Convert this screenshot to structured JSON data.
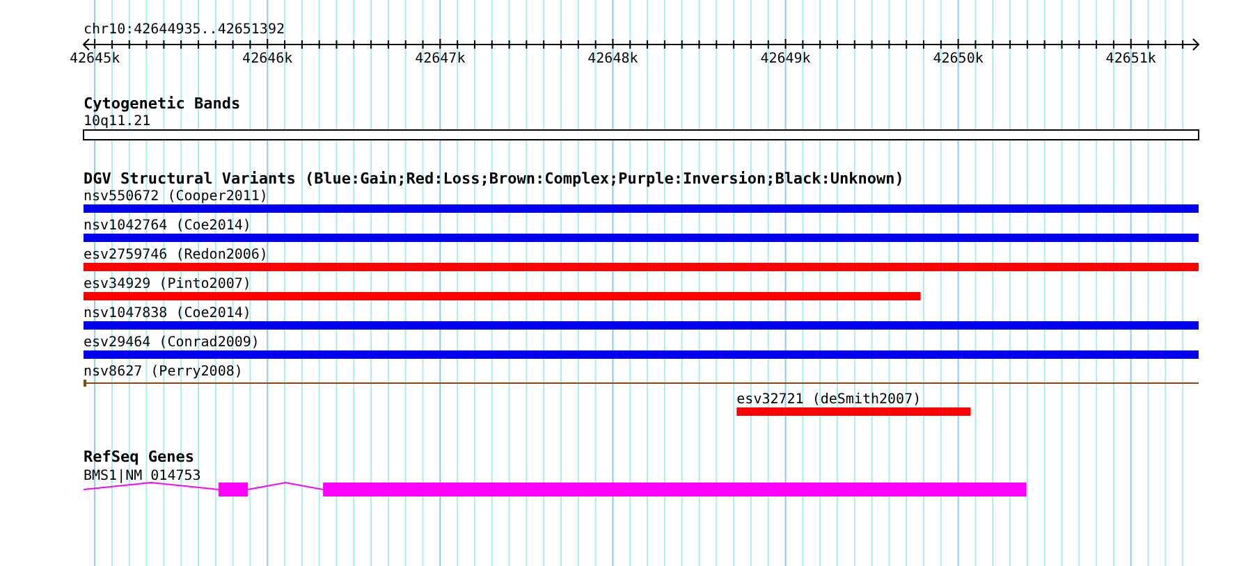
{
  "location": "chr10:42644935..42651392",
  "ruler": {
    "ticks": [
      "42645k",
      "42646k",
      "42647k",
      "42648k",
      "42649k",
      "42650k",
      "42651k"
    ]
  },
  "cytobands": {
    "title": "Cytogenetic Bands",
    "label": "10q11.21"
  },
  "variants": {
    "title": "DGV Structural Variants (Blue:Gain;Red:Loss;Brown:Complex;Purple:Inversion;Black:Unknown)",
    "features": [
      {
        "label": "nsv550672 (Cooper2011)",
        "kind": "bar",
        "color": "#0000ee"
      },
      {
        "label": "nsv1042764 (Coe2014)",
        "kind": "bar",
        "color": "#0000ee"
      },
      {
        "label": "esv2759746 (Redon2006)",
        "kind": "bar",
        "color": "#ff0000"
      },
      {
        "label": "esv34929 (Pinto2007)",
        "kind": "bar",
        "color": "#ff0000"
      },
      {
        "label": "nsv1047838 (Coe2014)",
        "kind": "bar",
        "color": "#0000ee"
      },
      {
        "label": "esv29464 (Conrad2009)",
        "kind": "bar",
        "color": "#0000ee"
      },
      {
        "label": "nsv8627 (Perry2008)",
        "kind": "line",
        "color": "#8b4513"
      },
      {
        "label": "esv32721 (deSmith2007)",
        "kind": "bar",
        "color": "#ff0000"
      }
    ]
  },
  "genes": {
    "title": "RefSeq Genes",
    "label": "BMS1|NM_014753"
  }
}
